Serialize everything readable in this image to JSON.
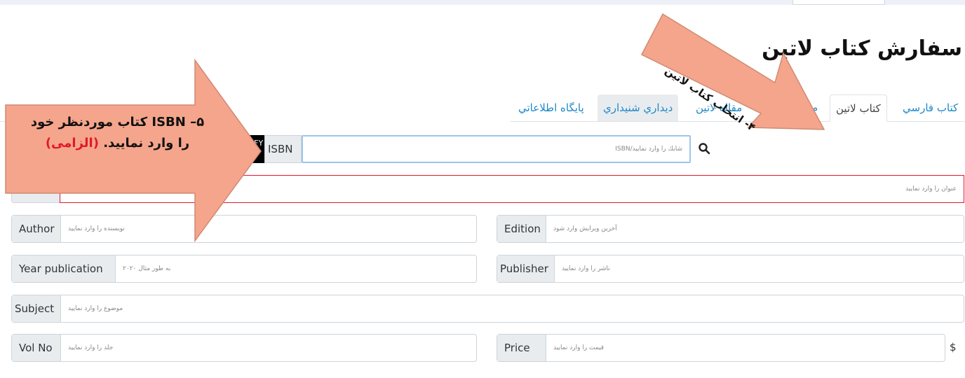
{
  "page": {
    "title": "سفارش کتاب لاتین"
  },
  "tabs": [
    {
      "label": "کتاب فارسي",
      "active": false
    },
    {
      "label": "کتاب لاتین",
      "active": true
    },
    {
      "label": "م",
      "active": false
    },
    {
      "label": "مقاله لاتین",
      "active": false
    },
    {
      "label": "ديداري شنيداري",
      "active": false
    },
    {
      "label": "پايگاه اطلاعاتي",
      "active": false
    }
  ],
  "isbn": {
    "label": "ISBN",
    "placeholder": "شابك را وارد نماييد/ISBN",
    "badge_text": "N/ FY"
  },
  "fields": {
    "title": {
      "placeholder": "عنوان را وارد نماييد"
    },
    "author": {
      "label": "Author",
      "placeholder": "نويسنده را وارد نماييد"
    },
    "edition": {
      "label": "Edition",
      "placeholder": "آخرین ويرايش وارد شود"
    },
    "year": {
      "label": "Year publication",
      "placeholder": "به طور مثال ۲۰۲۰"
    },
    "publisher": {
      "label": "Publisher",
      "placeholder": "ناشر را وارد نماييد"
    },
    "subject": {
      "label": "Subject",
      "placeholder": "موضوع را وارد نماييد"
    },
    "volno": {
      "label": "Vol No",
      "placeholder": "جلد را وارد نماييد"
    },
    "price": {
      "label": "Price",
      "placeholder": "قیمت را وارد نماييد",
      "currency": "$"
    }
  },
  "annotations": {
    "step4": "۴- انتخاب کتاب لاتین",
    "step5_line1": "۵– ISBN  کتاب موردنظر خود",
    "step5_line2": "را وارد نمایید.",
    "step5_required": "(الزامی)"
  },
  "colors": {
    "arrow_fill": "#f5a58c",
    "arrow_stroke": "#d08a72",
    "link": "#1e88c8",
    "required": "#e0192a",
    "error_border": "#e0192a"
  },
  "icons": {
    "search": "search-icon"
  }
}
